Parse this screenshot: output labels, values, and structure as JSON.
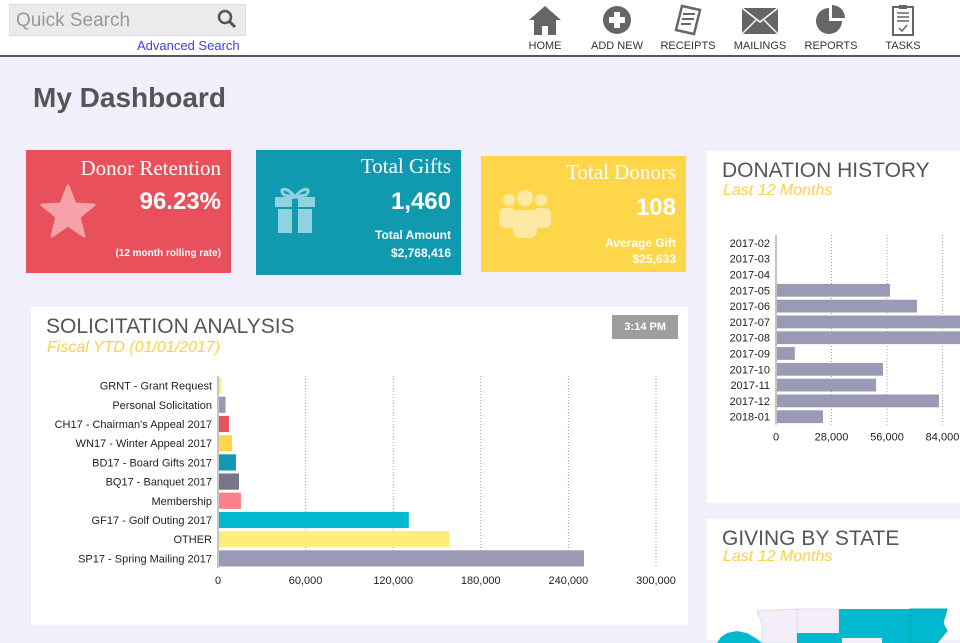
{
  "header": {
    "search_placeholder": "Quick Search",
    "advanced_search": "Advanced Search",
    "nav": [
      {
        "label": "HOME",
        "icon": "home-icon"
      },
      {
        "label": "ADD NEW",
        "icon": "plus-circle-icon"
      },
      {
        "label": "RECEIPTS",
        "icon": "receipt-icon"
      },
      {
        "label": "MAILINGS",
        "icon": "envelope-icon"
      },
      {
        "label": "REPORTS",
        "icon": "pie-chart-icon"
      },
      {
        "label": "TASKS",
        "icon": "clipboard-icon"
      }
    ]
  },
  "page_title": "My Dashboard",
  "cards": {
    "retention": {
      "title": "Donor Retention",
      "value": "96.23%",
      "note": "(12 month rolling rate)",
      "color": "#e8505b"
    },
    "gifts": {
      "title": "Total Gifts",
      "value": "1,460",
      "sub_label": "Total Amount",
      "sub_value": "$2,768,416",
      "color": "#1199b0"
    },
    "donors": {
      "title": "Total Donors",
      "value": "108",
      "sub_label": "Average Gift",
      "sub_value": "$25,633",
      "color": "#fdd64a"
    }
  },
  "solicitation": {
    "title": "SOLICITATION ANALYSIS",
    "subtitle": "Fiscal YTD (01/01/2017)",
    "time": "3:14 PM"
  },
  "donation_history": {
    "title": "DONATION HISTORY",
    "subtitle": "Last 12 Months"
  },
  "giving_by_state": {
    "title": "GIVING BY STATE",
    "subtitle": "Last 12 Months"
  },
  "chart_data": [
    {
      "type": "bar",
      "orientation": "horizontal",
      "title": "SOLICITATION ANALYSIS",
      "categories": [
        "GRNT - Grant Request",
        "Personal Solicitation",
        "CH17 - Chairman's Appeal 2017",
        "WN17 - Winter Appeal 2017",
        "BD17 - Board Gifts 2017",
        "BQ17 - Banquet 2017",
        "Membership",
        "GF17 - Golf Outing 2017",
        "OTHER",
        "SP17 - Spring Mailing 2017"
      ],
      "values": [
        1400,
        4500,
        6800,
        8900,
        11600,
        13700,
        15000,
        130000,
        158000,
        250000
      ],
      "colors": [
        "#fdee7a",
        "#9b9ab6",
        "#e8505b",
        "#fdd64a",
        "#1199b0",
        "#767689",
        "#fd8088",
        "#00b8d0",
        "#fdee7a",
        "#9b9ab6"
      ],
      "xlim": [
        0,
        300000
      ],
      "xticks": [
        "0",
        "60,000",
        "120,000",
        "180,000",
        "240,000",
        "300,000"
      ],
      "grid": "vertical dotted"
    },
    {
      "type": "bar",
      "orientation": "horizontal",
      "title": "DONATION HISTORY",
      "categories": [
        "2017-02",
        "2017-03",
        "2017-04",
        "2017-05",
        "2017-06",
        "2017-07",
        "2017-08",
        "2017-09",
        "2017-10",
        "2017-11",
        "2017-12",
        "2018-01"
      ],
      "values": [
        0,
        0,
        0,
        57000,
        70600,
        95000,
        95000,
        9000,
        53500,
        50000,
        81700,
        23200
      ],
      "color": "#9b9ab6",
      "xlim": [
        0,
        112000
      ],
      "xticks": [
        "0",
        "28,000",
        "56,000",
        "84,000"
      ],
      "grid": "vertical dotted"
    }
  ]
}
